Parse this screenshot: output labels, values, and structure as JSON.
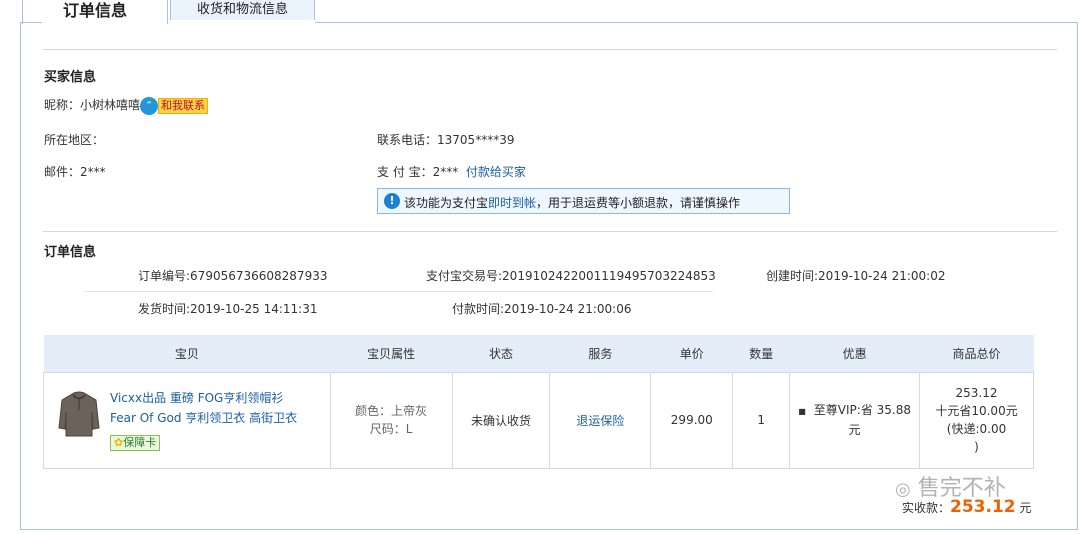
{
  "tabs": {
    "order_info": "订单信息",
    "logistics": "收货和物流信息"
  },
  "buyer": {
    "section_title": "买家信息",
    "nickname_label": "昵称：",
    "nickname": "小树林嘻嘻",
    "contact_badge": "和我联系",
    "region_label": "所在地区：",
    "region": "",
    "phone_label": "联系电话：",
    "phone": "13705****39",
    "email_label": "邮件：",
    "email": "2***",
    "alipay_label": "支 付 宝：",
    "alipay": "2***",
    "pay_to_buyer": "付款给买家",
    "notice_prefix": "该功能为支付宝",
    "notice_link": "即时到帐",
    "notice_suffix": "，用于退运费等小额退款，请谨慎操作"
  },
  "order": {
    "section_title": "订单信息",
    "order_no_label": "订单编号:",
    "order_no": "679056736608287933",
    "alipay_trade_label": "支付宝交易号:",
    "alipay_trade_no": "2019102422001119495703224853",
    "created_label": "创建时间:",
    "created": "2019-10-24 21:00:02",
    "shipped_label": "发货时间:",
    "shipped": "2019-10-25 14:11:31",
    "paid_label": "付款时间:",
    "paid": "2019-10-24 21:00:06"
  },
  "table": {
    "headers": [
      "宝贝",
      "宝贝属性",
      "状态",
      "服务",
      "单价",
      "数量",
      "优惠",
      "商品总价"
    ],
    "row": {
      "title_line1": "Vicxx出品 重磅 FOG亨利领帽衫",
      "title_line2": "Fear Of God 亨利领卫衣 高街卫衣",
      "guarantee": "保障卡",
      "attr_color": "颜色：上帝灰",
      "attr_size": "尺码：L",
      "status": "未确认收货",
      "service": "退运保险",
      "unit_price": "299.00",
      "quantity": "1",
      "discount_line1": "至尊VIP:省 35.88",
      "discount_line2": "元",
      "total_line1": "253.12",
      "total_line2": "十元省10.00元",
      "total_line3": "(快递:0.00",
      "total_line4": ")"
    }
  },
  "summary": {
    "label": "实收款：",
    "amount": "253.12",
    "unit": "元"
  },
  "watermark": "售完不补",
  "colors": {
    "link": "#1a5ea8",
    "amount": "#f06000",
    "header_bg": "#e3eef9",
    "border": "#a9c3df"
  }
}
